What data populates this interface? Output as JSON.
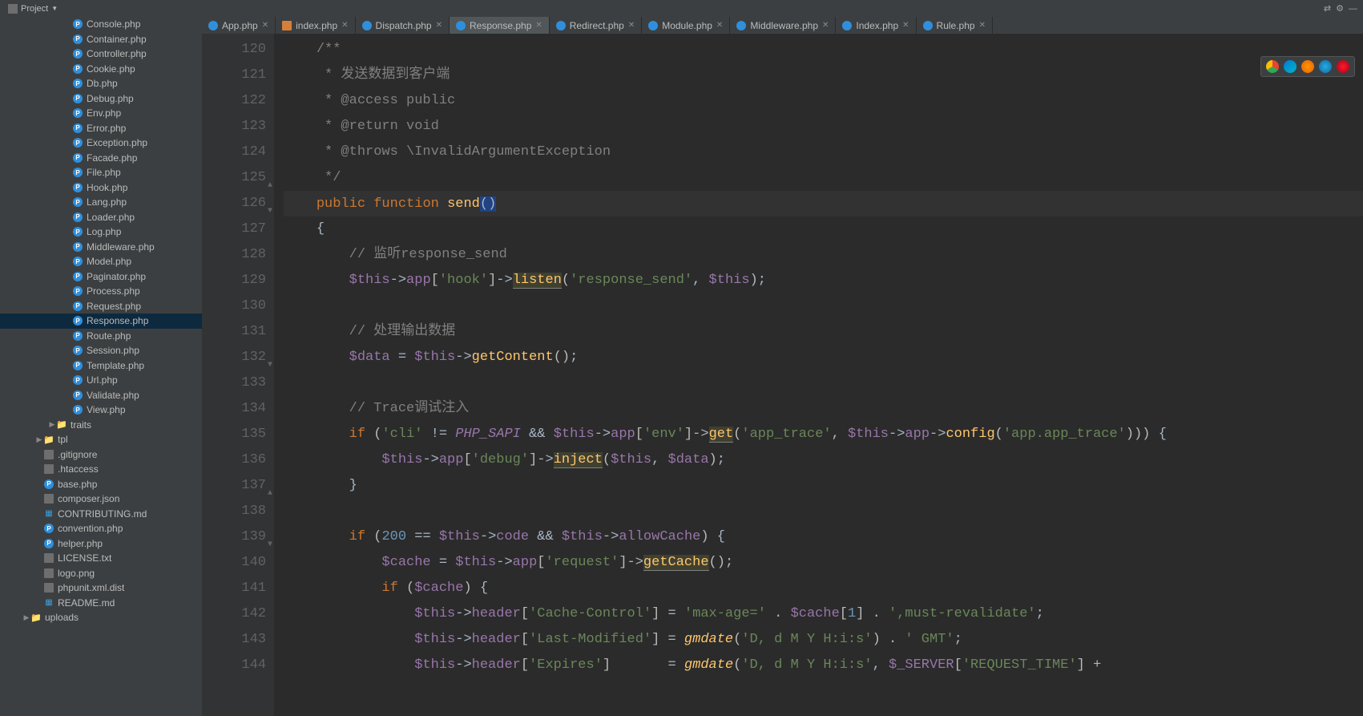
{
  "toolbar": {
    "project_label": "Project"
  },
  "tabs": [
    {
      "label": "App.php",
      "icon": "php",
      "active": false
    },
    {
      "label": "index.php",
      "icon": "idx",
      "active": false
    },
    {
      "label": "Dispatch.php",
      "icon": "php",
      "active": false
    },
    {
      "label": "Response.php",
      "icon": "php",
      "active": true
    },
    {
      "label": "Redirect.php",
      "icon": "php",
      "active": false
    },
    {
      "label": "Module.php",
      "icon": "php",
      "active": false
    },
    {
      "label": "Middleware.php",
      "icon": "php",
      "active": false
    },
    {
      "label": "Index.php",
      "icon": "php",
      "active": false
    },
    {
      "label": "Rule.php",
      "icon": "php",
      "active": false
    }
  ],
  "sidebarFiles": [
    {
      "indent": 80,
      "icon": "php",
      "label": "Console.php"
    },
    {
      "indent": 80,
      "icon": "php",
      "label": "Container.php"
    },
    {
      "indent": 80,
      "icon": "php",
      "label": "Controller.php"
    },
    {
      "indent": 80,
      "icon": "php",
      "label": "Cookie.php"
    },
    {
      "indent": 80,
      "icon": "php",
      "label": "Db.php"
    },
    {
      "indent": 80,
      "icon": "php",
      "label": "Debug.php"
    },
    {
      "indent": 80,
      "icon": "php",
      "label": "Env.php"
    },
    {
      "indent": 80,
      "icon": "php",
      "label": "Error.php"
    },
    {
      "indent": 80,
      "icon": "php",
      "label": "Exception.php"
    },
    {
      "indent": 80,
      "icon": "php",
      "label": "Facade.php"
    },
    {
      "indent": 80,
      "icon": "php",
      "label": "File.php"
    },
    {
      "indent": 80,
      "icon": "php",
      "label": "Hook.php"
    },
    {
      "indent": 80,
      "icon": "php",
      "label": "Lang.php"
    },
    {
      "indent": 80,
      "icon": "php",
      "label": "Loader.php"
    },
    {
      "indent": 80,
      "icon": "php",
      "label": "Log.php"
    },
    {
      "indent": 80,
      "icon": "php",
      "label": "Middleware.php"
    },
    {
      "indent": 80,
      "icon": "php",
      "label": "Model.php"
    },
    {
      "indent": 80,
      "icon": "php",
      "label": "Paginator.php"
    },
    {
      "indent": 80,
      "icon": "php",
      "label": "Process.php"
    },
    {
      "indent": 80,
      "icon": "php",
      "label": "Request.php"
    },
    {
      "indent": 80,
      "icon": "php",
      "label": "Response.php",
      "sel": true
    },
    {
      "indent": 80,
      "icon": "php",
      "label": "Route.php"
    },
    {
      "indent": 80,
      "icon": "php",
      "label": "Session.php"
    },
    {
      "indent": 80,
      "icon": "php",
      "label": "Template.php"
    },
    {
      "indent": 80,
      "icon": "php",
      "label": "Url.php"
    },
    {
      "indent": 80,
      "icon": "php",
      "label": "Validate.php"
    },
    {
      "indent": 80,
      "icon": "php",
      "label": "View.php"
    },
    {
      "indent": 60,
      "icon": "folder",
      "label": "traits",
      "arrow": "▶"
    },
    {
      "indent": 44,
      "icon": "folder",
      "label": "tpl",
      "arrow": "▶"
    },
    {
      "indent": 44,
      "icon": "file",
      "label": ".gitignore"
    },
    {
      "indent": 44,
      "icon": "file",
      "label": ".htaccess"
    },
    {
      "indent": 44,
      "icon": "php",
      "label": "base.php"
    },
    {
      "indent": 44,
      "icon": "json",
      "label": "composer.json"
    },
    {
      "indent": 44,
      "icon": "md",
      "label": "CONTRIBUTING.md"
    },
    {
      "indent": 44,
      "icon": "php",
      "label": "convention.php"
    },
    {
      "indent": 44,
      "icon": "php",
      "label": "helper.php"
    },
    {
      "indent": 44,
      "icon": "txt",
      "label": "LICENSE.txt"
    },
    {
      "indent": 44,
      "icon": "png",
      "label": "logo.png"
    },
    {
      "indent": 44,
      "icon": "file",
      "label": "phpunit.xml.dist"
    },
    {
      "indent": 44,
      "icon": "md",
      "label": "README.md"
    },
    {
      "indent": 28,
      "icon": "folder",
      "label": "uploads",
      "arrow": "▶"
    }
  ],
  "code": {
    "startLine": 120,
    "caretLine": 126,
    "lines": [
      {
        "n": 120,
        "html": "    <span class='c-comment'>/**</span>"
      },
      {
        "n": 121,
        "html": "    <span class='c-comment'> * 发送数据到客户端</span>"
      },
      {
        "n": 122,
        "html": "    <span class='c-comment'> * @access public</span>"
      },
      {
        "n": 123,
        "html": "    <span class='c-comment'> * @return void</span>"
      },
      {
        "n": 124,
        "html": "    <span class='c-comment'> * @throws \\InvalidArgumentException</span>"
      },
      {
        "n": 125,
        "html": "    <span class='c-comment'> */</span>",
        "fold": "▲"
      },
      {
        "n": 126,
        "html": "    <span class='c-kw'>public</span> <span class='c-kw'>function</span> <span class='c-fn'>send</span><span class='c-paren c-hl'>()</span>",
        "fold": "▼"
      },
      {
        "n": 127,
        "html": "    <span class='c-paren'>{</span>"
      },
      {
        "n": 128,
        "html": "        <span class='c-comment'>// 监听response_send</span>"
      },
      {
        "n": 129,
        "html": "        <span class='c-var'>$this</span><span class='c-op'>-></span><span class='c-var'>app</span>[<span class='c-str'>'hook'</span>]<span class='c-op'>-></span><span class='c-fn c-underline'>listen</span>(<span class='c-str'>'response_send'</span><span class='c-op'>,</span> <span class='c-var'>$this</span>)<span class='c-op'>;</span>"
      },
      {
        "n": 130,
        "html": ""
      },
      {
        "n": 131,
        "html": "        <span class='c-comment'>// 处理输出数据</span>"
      },
      {
        "n": 132,
        "html": "        <span class='c-var'>$data</span> <span class='c-op'>=</span> <span class='c-var'>$this</span><span class='c-op'>-></span><span class='c-fn'>getContent</span>()<span class='c-op'>;</span>",
        "fold": "▼"
      },
      {
        "n": 133,
        "html": ""
      },
      {
        "n": 134,
        "html": "        <span class='c-comment'>// Trace调试注入</span>"
      },
      {
        "n": 135,
        "html": "        <span class='c-kw'>if</span> (<span class='c-str'>'cli'</span> <span class='c-op'>!=</span> <span class='c-const'>PHP_SAPI</span> <span class='c-op'>&amp;&amp;</span> <span class='c-var'>$this</span><span class='c-op'>-></span><span class='c-var'>app</span>[<span class='c-str'>'env'</span>]<span class='c-op'>-></span><span class='c-fn c-underline'>get</span>(<span class='c-str'>'app_trace'</span><span class='c-op'>,</span> <span class='c-var'>$this</span><span class='c-op'>-></span><span class='c-var'>app</span><span class='c-op'>-></span><span class='c-fn'>config</span>(<span class='c-str'>'app.app_trace'</span>))) <span class='c-paren'>{</span>"
      },
      {
        "n": 136,
        "html": "            <span class='c-var'>$this</span><span class='c-op'>-></span><span class='c-var'>app</span>[<span class='c-str'>'debug'</span>]<span class='c-op'>-></span><span class='c-fn c-underline'>inject</span>(<span class='c-var'>$this</span><span class='c-op'>,</span> <span class='c-var'>$data</span>)<span class='c-op'>;</span>"
      },
      {
        "n": 137,
        "html": "        <span class='c-paren'>}</span>",
        "fold": "▲"
      },
      {
        "n": 138,
        "html": ""
      },
      {
        "n": 139,
        "html": "        <span class='c-kw'>if</span> (<span class='c-num'>200</span> <span class='c-op'>==</span> <span class='c-var'>$this</span><span class='c-op'>-></span><span class='c-var'>code</span> <span class='c-op'>&amp;&amp;</span> <span class='c-var'>$this</span><span class='c-op'>-></span><span class='c-var'>allowCache</span>) <span class='c-paren'>{</span>",
        "fold": "▼"
      },
      {
        "n": 140,
        "html": "            <span class='c-var'>$cache</span> <span class='c-op'>=</span> <span class='c-var'>$this</span><span class='c-op'>-></span><span class='c-var'>app</span>[<span class='c-str'>'request'</span>]<span class='c-op'>-></span><span class='c-fn c-underline'>getCache</span>()<span class='c-op'>;</span>"
      },
      {
        "n": 141,
        "html": "            <span class='c-kw'>if</span> (<span class='c-var'>$cache</span>) <span class='c-paren'>{</span>"
      },
      {
        "n": 142,
        "html": "                <span class='c-var'>$this</span><span class='c-op'>-></span><span class='c-var'>header</span>[<span class='c-str'>'Cache-Control'</span>] <span class='c-op'>=</span> <span class='c-str'>'max-age='</span> <span class='c-op'>.</span> <span class='c-var'>$cache</span>[<span class='c-num'>1</span>] <span class='c-op'>.</span> <span class='c-str'>',must-revalidate'</span><span class='c-op'>;</span>"
      },
      {
        "n": 143,
        "html": "                <span class='c-var'>$this</span><span class='c-op'>-></span><span class='c-var'>header</span>[<span class='c-str'>'Last-Modified'</span>] <span class='c-op'>=</span> <span class='c-fn' style='font-style:italic'>gmdate</span>(<span class='c-str'>'D, d M Y H:i:s'</span>) <span class='c-op'>.</span> <span class='c-str'>' GMT'</span><span class='c-op'>;</span>"
      },
      {
        "n": 144,
        "html": "                <span class='c-var'>$this</span><span class='c-op'>-></span><span class='c-var'>header</span>[<span class='c-str'>'Expires'</span>]       <span class='c-op'>=</span> <span class='c-fn' style='font-style:italic'>gmdate</span>(<span class='c-str'>'D, d M Y H:i:s'</span><span class='c-op'>,</span> <span class='c-var'>$_SERVER</span>[<span class='c-str'>'REQUEST_TIME'</span>] <span class='c-op'>+</span>"
      }
    ]
  }
}
